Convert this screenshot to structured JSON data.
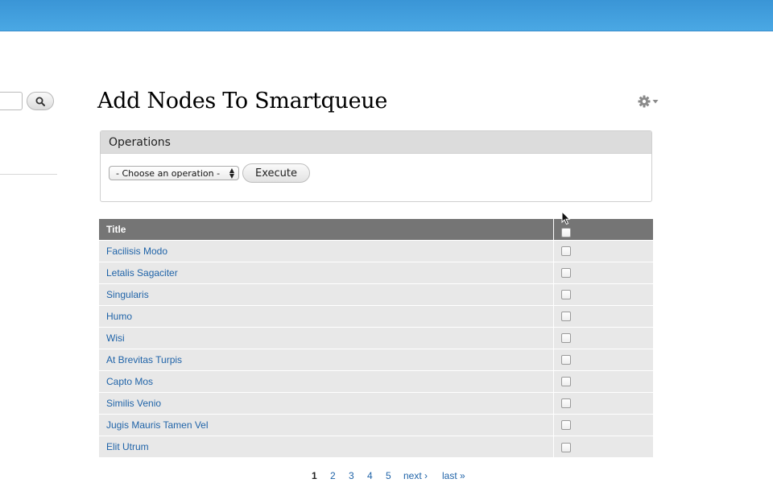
{
  "colors": {
    "topbar": "#4aa8e4",
    "link": "#1f63a8",
    "table_header": "#757575",
    "row_bg": "#e8e8e8"
  },
  "sidebar": {
    "search_icon": "search-icon"
  },
  "header": {
    "title": "Add Nodes To Smartqueue",
    "gear_icon": "gear-icon"
  },
  "operations": {
    "legend": "Operations",
    "select_value": "- Choose an operation -",
    "execute_label": "Execute"
  },
  "table": {
    "columns": [
      "Title"
    ],
    "rows": [
      {
        "title": "Facilisis Modo"
      },
      {
        "title": "Letalis Sagaciter"
      },
      {
        "title": "Singularis"
      },
      {
        "title": "Humo"
      },
      {
        "title": "Wisi"
      },
      {
        "title": "At Brevitas Turpis"
      },
      {
        "title": "Capto Mos"
      },
      {
        "title": "Similis Venio"
      },
      {
        "title": "Jugis Mauris Tamen Vel"
      },
      {
        "title": "Elit Utrum"
      }
    ]
  },
  "pager": {
    "current": "1",
    "pages": [
      "2",
      "3",
      "4",
      "5"
    ],
    "next": "next ›",
    "last": "last »"
  }
}
